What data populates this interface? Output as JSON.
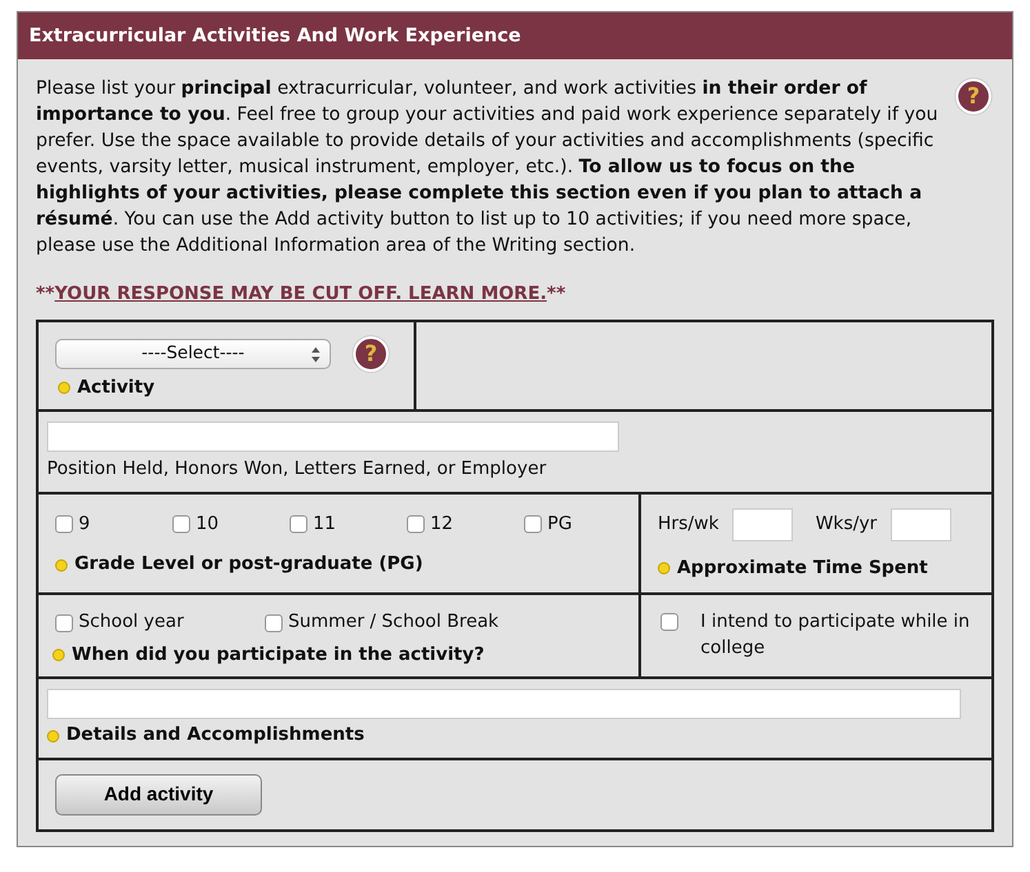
{
  "panel": {
    "title": "Extracurricular Activities And Work Experience",
    "intro": "Please list your **principal** extracurricular, volunteer, and work activities **in their order of importance to you**. Feel free to group your activities and paid work experience separately if you prefer. Use the space available to provide details of your activities and accomplishments (specific events, varsity letter, musical instrument, employer, etc.). **To allow us to focus on the highlights of your activities, please complete this section even if you plan to attach a résumé**. You can use the Add activity button to list up to 10 activities; if you need more space, please use the Additional Information area of the Writing section.",
    "help_icon": "?",
    "warning": {
      "prefix": "**",
      "link": "YOUR RESPONSE MAY BE CUT OFF. LEARN MORE.",
      "suffix": "**"
    }
  },
  "form": {
    "activity": {
      "select_value": "----Select----",
      "help_icon": "?",
      "label": "Activity",
      "required": true
    },
    "position": {
      "label": "Position Held, Honors Won, Letters Earned, or Employer"
    },
    "grades": {
      "options": [
        {
          "label": "9",
          "checked": false
        },
        {
          "label": "10",
          "checked": false
        },
        {
          "label": "11",
          "checked": false
        },
        {
          "label": "12",
          "checked": false
        },
        {
          "label": "PG",
          "checked": false
        }
      ],
      "label": "Grade Level or post-graduate (PG)",
      "required": true
    },
    "time": {
      "fields": [
        {
          "label": "Hrs/wk"
        },
        {
          "label": "Wks/yr"
        }
      ],
      "label": "Approximate Time Spent",
      "required": true
    },
    "when": {
      "options": [
        {
          "label": "School year",
          "checked": false
        },
        {
          "label": "Summer / School Break",
          "checked": false
        }
      ],
      "label": "When did you participate in the activity?",
      "required": true
    },
    "college": {
      "label": "I intend to participate while in college",
      "checked": false
    },
    "details": {
      "label": "Details and Accomplishments",
      "required": true
    },
    "add_button": "Add activity"
  }
}
